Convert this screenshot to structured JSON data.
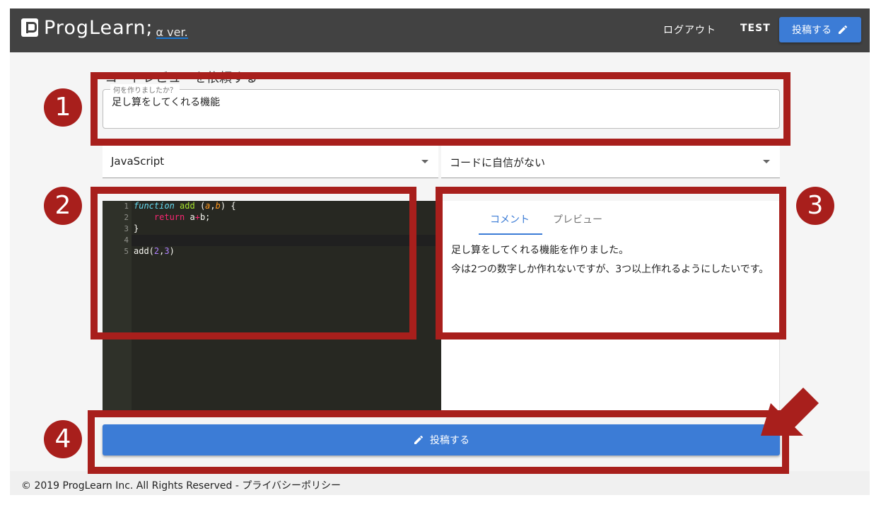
{
  "header": {
    "logo_text": "ProgLearn;",
    "logo_version": "α ver.",
    "logout_label": "ログアウト",
    "username": "TEST",
    "post_label": "投稿する"
  },
  "page": {
    "title": "コードレビューを依頼する"
  },
  "form": {
    "title_label": "何を作りましたか？",
    "title_value": "足し算をしてくれる機能",
    "language": "JavaScript",
    "confidence": "コードに自信がない"
  },
  "editor": {
    "line_numbers": [
      "1",
      "2",
      "3",
      "4",
      "5"
    ],
    "code": [
      "function add (a,b) {",
      "    return a+b;",
      "}",
      "",
      "add(2,3)"
    ]
  },
  "preview": {
    "tabs": [
      "コメント",
      "プレビュー"
    ],
    "active_tab": "コメント",
    "comment_lines": [
      "足し算をしてくれる機能を作りました。",
      "今は2つの数字しか作れないですが、3つ以上作れるようにしたいです。"
    ]
  },
  "submit": {
    "label": "投稿する"
  },
  "footer": {
    "text": "© 2019 ProgLearn Inc. All Rights Reserved - プライバシーポリシー"
  },
  "annotations": {
    "labels": [
      "1",
      "2",
      "3",
      "4"
    ],
    "color": "#a81f1c"
  },
  "colors": {
    "appbar": "#424242",
    "primary": "#3c7cd6",
    "editor_bg": "#272822"
  }
}
